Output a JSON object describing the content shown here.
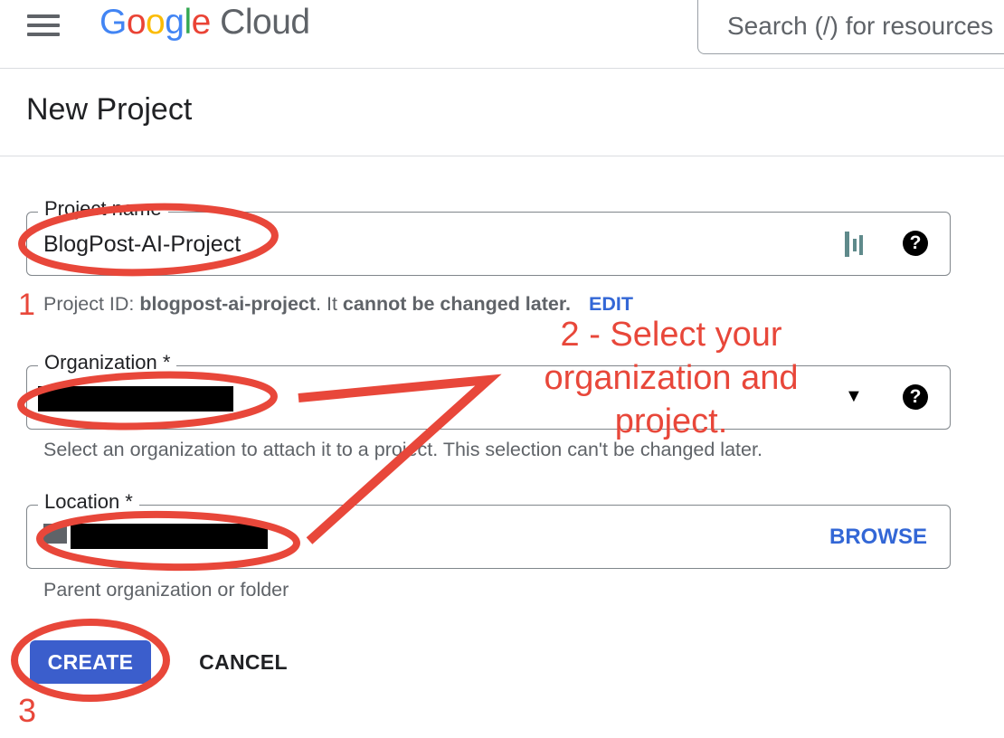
{
  "header": {
    "brand_google": [
      "G",
      "o",
      "o",
      "g",
      "l",
      "e"
    ],
    "brand_colors": [
      "#4285F4",
      "#EA4335",
      "#FBBC05",
      "#4285F4",
      "#34A853",
      "#EA4335"
    ],
    "brand_cloud": "Cloud",
    "search_placeholder": "Search (/) for resources"
  },
  "page": {
    "title": "New Project"
  },
  "form": {
    "project_name": {
      "label": "Project name",
      "value": "BlogPost-AI-Project",
      "hint_prefix": "Project ID: ",
      "project_id": "blogpost-ai-project",
      "hint_mid": ". It ",
      "hint_bold": "cannot be changed later.",
      "edit_label": "EDIT"
    },
    "organization": {
      "label": "Organization *",
      "hint": "Select an organization to attach it to a project. This selection can't be changed later."
    },
    "location": {
      "label": "Location *",
      "browse_label": "BROWSE",
      "hint": "Parent organization or folder"
    }
  },
  "actions": {
    "create_label": "CREATE",
    "cancel_label": "CANCEL"
  },
  "annotations": {
    "step1": "1",
    "step2_lines": [
      "2 - Select your",
      "organization and",
      "project."
    ],
    "step3": "3",
    "color": "#e8473a"
  },
  "icons": {
    "menu": "hamburger-icon",
    "help": "?",
    "dropdown": "▼",
    "bar_chart": "bar-chart-icon"
  }
}
